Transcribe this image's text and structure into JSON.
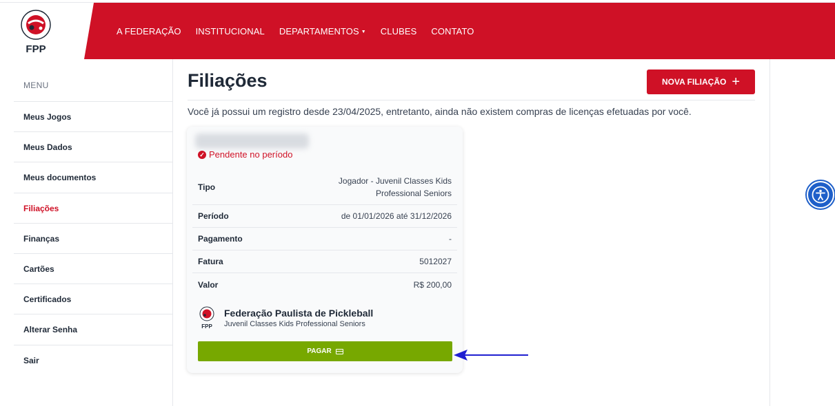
{
  "header": {
    "logo_text": "FPP",
    "logo_ring_text": "FEDERAÇÃO PAULISTA DE PICKLEBALL",
    "nav": [
      "A FEDERAÇÃO",
      "INSTITUCIONAL",
      "DEPARTAMENTOS",
      "CLUBES",
      "CONTATO"
    ],
    "brand_color": "#cf1126"
  },
  "sidebar": {
    "title": "MENU",
    "items": [
      {
        "label": "Meus Jogos"
      },
      {
        "label": "Meus Dados"
      },
      {
        "label": "Meus documentos"
      },
      {
        "label": "Filiações"
      },
      {
        "label": "Finanças"
      },
      {
        "label": "Cartões"
      },
      {
        "label": "Certificados"
      },
      {
        "label": "Alterar Senha"
      },
      {
        "label": "Sair"
      }
    ],
    "active": "Filiações"
  },
  "main": {
    "title": "Filiações",
    "new_button": "NOVA FILIAÇÃO",
    "notice": "Você já possui um registro desde 23/04/2025, entretanto, ainda não existem compras de licenças efetuadas por você."
  },
  "card": {
    "status": "Pendente no período",
    "rows": [
      {
        "key": "Tipo",
        "value_line1": "Jogador - Juvenil Classes Kids",
        "value_line2": "Professional Seniors"
      },
      {
        "key": "Período",
        "value": "de 01/01/2026 até 31/12/2026"
      },
      {
        "key": "Pagamento",
        "value": "-"
      },
      {
        "key": "Fatura",
        "value": "5012027"
      },
      {
        "key": "Valor",
        "value": "R$ 200,00"
      }
    ],
    "org_name": "Federação Paulista de Pickleball",
    "org_sub": "Juvenil Classes Kids Professional Seniors",
    "org_logo_text": "FPP",
    "pay_button": "PAGAR",
    "pay_color": "#77a800"
  },
  "accessibility_icon": "accessibility-icon"
}
